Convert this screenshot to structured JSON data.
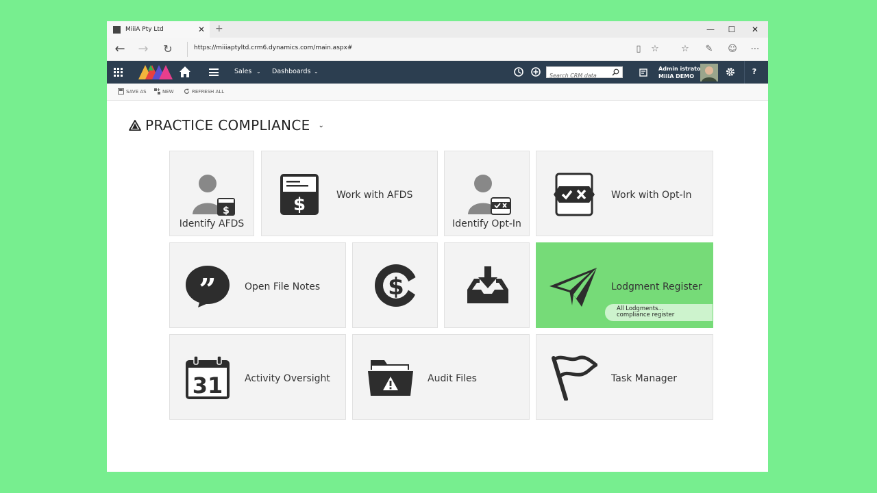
{
  "browser": {
    "tab_title": "MiiiA Pty Ltd",
    "new_tab": "+",
    "tab_close": "✕",
    "url": "https://miiiaptyltd.crm6.dynamics.com/main.aspx#",
    "window_controls": {
      "minimize": "—",
      "maximize": "☐",
      "close": "✕"
    }
  },
  "crm_nav": {
    "items": [
      {
        "label": "Sales"
      },
      {
        "label": "Dashboards"
      }
    ],
    "search_placeholder": "Search CRM data",
    "user_name": "Admin istrator",
    "user_org": "MiiiA DEMO",
    "help": "?"
  },
  "command_bar": {
    "save_as": "SAVE AS",
    "new": "NEW",
    "refresh_all": "REFRESH ALL"
  },
  "page": {
    "title": "PRACTICE COMPLIANCE"
  },
  "tiles": {
    "identify_afds": "Identify AFDS",
    "work_with_afds": "Work with AFDS",
    "identify_opt_in": "Identify Opt-In",
    "work_with_opt_in": "Work with Opt-In",
    "open_file_notes": "Open File Notes",
    "lodgment_register": "Lodgment Register",
    "lodgment_note_line1": "All Lodgments...",
    "lodgment_note_line2": "compliance register",
    "activity_oversight": "Activity Oversight",
    "calendar_day": "31",
    "audit_files": "Audit Files",
    "task_manager": "Task Manager"
  },
  "colors": {
    "background": "#77ee8f",
    "crm_nav": "#2c3e50",
    "active_tile": "#76db78",
    "tile": "#f3f3f3"
  }
}
